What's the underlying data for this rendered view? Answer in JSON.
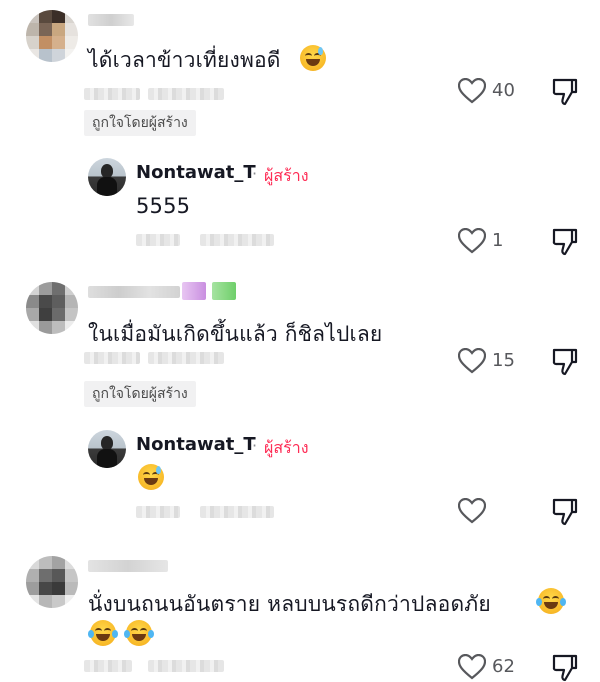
{
  "comments": [
    {
      "text": "ได้เวลาข้าวเที่ยงพอดี",
      "likes": "40",
      "badge": "ถูกใจโดยผู้สร้าง",
      "emoji": "sweat-smile-emoji",
      "reply": {
        "author": "Nontawat_T",
        "separator": "·",
        "creator_tag": "ผู้สร้าง",
        "text": "5555",
        "likes": "1"
      }
    },
    {
      "text": "ในเมื่อมันเกิดขึ้นแล้ว ก็ชิลไปเลย",
      "likes": "15",
      "badge": "ถูกใจโดยผู้สร้าง",
      "reply": {
        "author": "Nontawat_T",
        "separator": "·",
        "creator_tag": "ผู้สร้าง",
        "emoji": "sweat-smile-emoji",
        "likes": ""
      }
    },
    {
      "text": "นั่งบนถนนอันตราย หลบบนรถดีกว่าปลอดภัย",
      "emojis": [
        "tears-of-joy-emoji",
        "tears-of-joy-emoji",
        "tears-of-joy-emoji"
      ],
      "likes": "62"
    }
  ],
  "colors": {
    "creator": "#fe2c55",
    "text": "#161823",
    "muted": "#57585c",
    "badge_bg": "#f1f1f2"
  },
  "icons": [
    "heart-icon",
    "dislike-icon",
    "avatar"
  ]
}
